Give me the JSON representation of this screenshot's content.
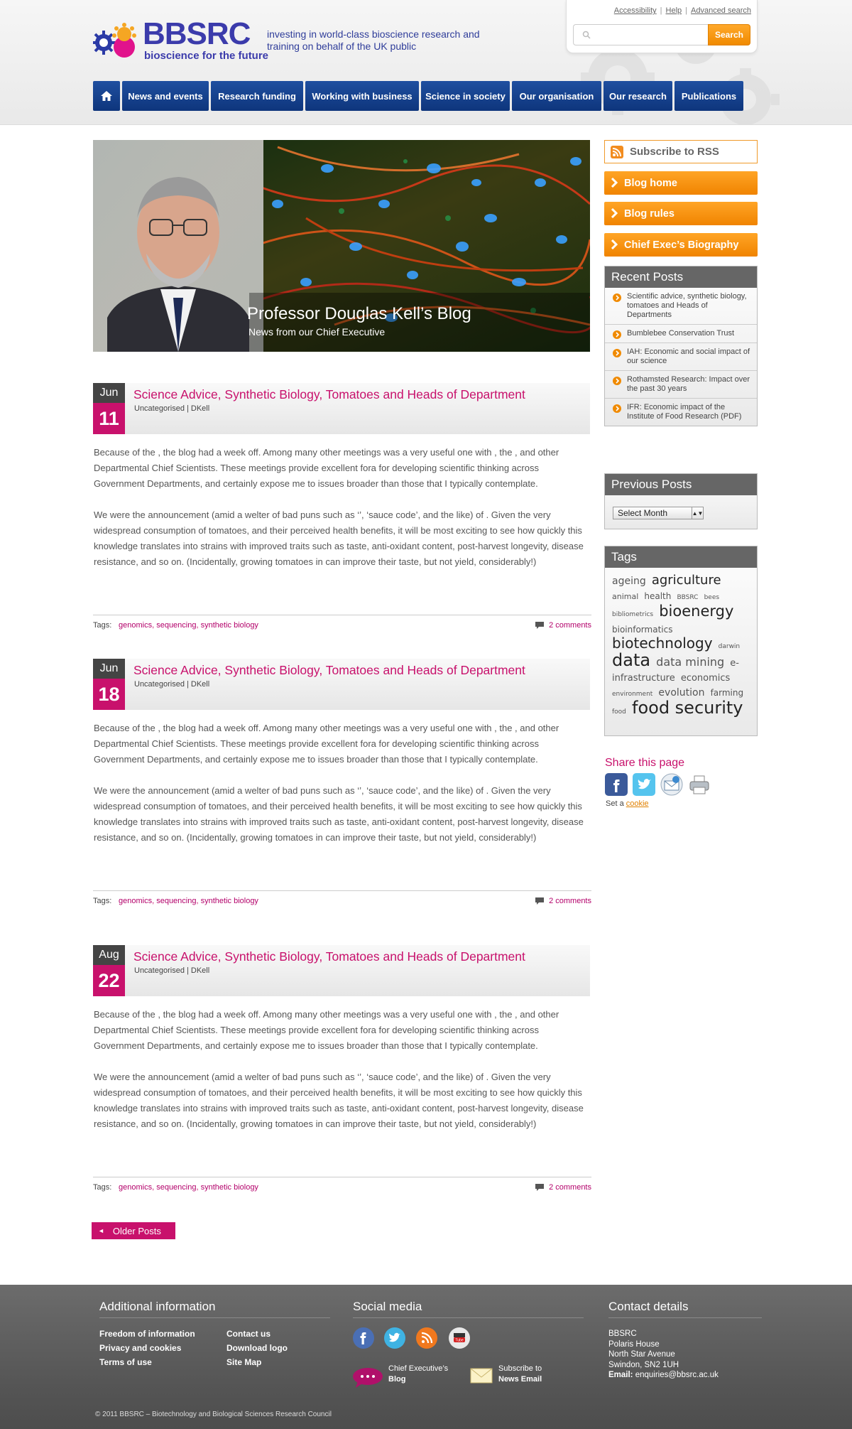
{
  "header": {
    "logo_text": "BBSRC",
    "logo_subtitle": "bioscience for the future",
    "tagline": "investing in world-class bioscience research and training on behalf of the UK public",
    "top_links": [
      "Accessibility",
      "Help",
      "Advanced search"
    ],
    "search_placeholder": "",
    "search_button": "Search"
  },
  "nav": {
    "items": [
      "News and events",
      "Research funding",
      "Working with business",
      "Science in society",
      "Our organisation",
      "Our research",
      "Publications"
    ]
  },
  "banner": {
    "title": "Professor Douglas Kell’s Blog",
    "subtitle": "News from our Chief Executive"
  },
  "posts": [
    {
      "month": "Jun",
      "day": "11",
      "title": "Science Advice, Synthetic Biology, Tomatoes and Heads of Department",
      "meta": "Uncategorised  |  DKell",
      "para1": "Because of the , the blog had a week off. Among many other meetings was a very useful one with , the , and other Departmental Chief Scientists. These meetings provide excellent fora for developing scientific thinking across Government Departments, and certainly expose me to issues broader than those that I typically contemplate.",
      "para2": "We were  the announcement (amid a welter of bad puns such as ‘’, ‘sauce code’, and the like) of . Given the very widespread consumption of tomatoes, and their perceived health benefits, it will be most exciting to see how quickly this knowledge translates into strains with improved traits such as taste, anti-oxidant content, post-harvest longevity, disease resistance, and so on. (Incidentally, growing tomatoes in  can improve their taste, but not yield, considerably!)",
      "tags_label": "Tags:",
      "tags": [
        "genomics",
        "sequencing",
        "synthetic biology"
      ],
      "comments": "2 comments"
    },
    {
      "month": "Jun",
      "day": "18",
      "title": "Science Advice, Synthetic Biology, Tomatoes and Heads of Department",
      "meta": "Uncategorised  |  DKell",
      "para1": "Because of the , the blog had a week off. Among many other meetings was a very useful one with , the , and other Departmental Chief Scientists. These meetings provide excellent fora for developing scientific thinking across Government Departments, and certainly expose me to issues broader than those that I typically contemplate.",
      "para2": "We were  the announcement (amid a welter of bad puns such as ‘’, ‘sauce code’, and the like) of . Given the very widespread consumption of tomatoes, and their perceived health benefits, it will be most exciting to see how quickly this knowledge translates into strains with improved traits such as taste, anti-oxidant content, post-harvest longevity, disease resistance, and so on. (Incidentally, growing tomatoes in  can improve their taste, but not yield, considerably!)",
      "tags_label": "Tags:",
      "tags": [
        "genomics",
        "sequencing",
        "synthetic biology"
      ],
      "comments": "2 comments"
    },
    {
      "month": "Aug",
      "day": "22",
      "title": "Science Advice, Synthetic Biology, Tomatoes and Heads of Department",
      "meta": "Uncategorised  |  DKell",
      "para1": "Because of the , the blog had a week off. Among many other meetings was a very useful one with , the , and other Departmental Chief Scientists. These meetings provide excellent fora for developing scientific thinking across Government Departments, and certainly expose me to issues broader than those that I typically contemplate.",
      "para2": "We were  the announcement (amid a welter of bad puns such as ‘’, ‘sauce code’, and the like) of . Given the very widespread consumption of tomatoes, and their perceived health benefits, it will be most exciting to see how quickly this knowledge translates into strains with improved traits such as taste, anti-oxidant content, post-harvest longevity, disease resistance, and so on. (Incidentally, growing tomatoes in  can improve their taste, but not yield, considerably!)",
      "tags_label": "Tags:",
      "tags": [
        "genomics",
        "sequencing",
        "synthetic biology"
      ],
      "comments": "2 comments"
    }
  ],
  "older_posts": "Older Posts",
  "sidebar": {
    "rss": "Subscribe to RSS",
    "buttons": [
      "Blog home",
      "Blog rules",
      "Chief Exec’s Biography"
    ],
    "recent_title": "Recent Posts",
    "recent_posts": [
      "Scientific advice, synthetic biology, tomatoes and Heads of Departments",
      "Bumblebee Conservation Trust",
      "IAH: Economic and social impact of our science",
      "Rothamsted Research: Impact over the past 30 years",
      "IFR: Economic impact of the Institute of Food Research (PDF)"
    ],
    "previous_title": "Previous Posts",
    "month_select": "Select Month",
    "tags_title": "Tags",
    "tag_cloud": [
      {
        "t": "ageing",
        "s": 14
      },
      {
        "t": "agriculture",
        "s": 18
      },
      {
        "t": "animal",
        "s": 11
      },
      {
        "t": "health",
        "s": 12
      },
      {
        "t": "BBSRC",
        "s": 9
      },
      {
        "t": "bees",
        "s": 9
      },
      {
        "t": "bibliometrics",
        "s": 9
      },
      {
        "t": "bioenergy",
        "s": 21
      },
      {
        "t": "bioinformatics",
        "s": 12
      },
      {
        "t": "biotechnology",
        "s": 20
      },
      {
        "t": "darwin",
        "s": 9
      },
      {
        "t": "data",
        "s": 24
      },
      {
        "t": "data mining",
        "s": 16
      },
      {
        "t": "e-infrastructure",
        "s": 13
      },
      {
        "t": "economics",
        "s": 13
      },
      {
        "t": "environment",
        "s": 9
      },
      {
        "t": "evolution",
        "s": 14
      },
      {
        "t": "farming",
        "s": 12
      },
      {
        "t": "food",
        "s": 9
      },
      {
        "t": "food security",
        "s": 24
      }
    ]
  },
  "share": {
    "title": "Share this page",
    "icons": [
      "facebook-icon",
      "twitter-icon",
      "email-icon",
      "print-icon"
    ],
    "cookie_prefix": "Set a",
    "cookie_link": "cookie"
  },
  "footer": {
    "additional_title": "Additional information",
    "links_col1": [
      "Freedom of information",
      "Privacy and cookies",
      "Terms of use"
    ],
    "links_col2": [
      "Contact us",
      "Download logo",
      "Site Map"
    ],
    "social_title": "Social media",
    "social_icons": [
      "facebook-icon",
      "twitter-icon",
      "rss-icon",
      "youtube-icon"
    ],
    "blog_link_line1": "Chief Executive’s",
    "blog_link_line2": "Blog",
    "news_link_line1": "Subscribe to",
    "news_link_line2": "News Email",
    "contact_title": "Contact details",
    "address": [
      "BBSRC",
      "Polaris House",
      "North Star Avenue",
      "Swindon, SN2 1UH"
    ],
    "email_label": "Email:",
    "email": "enquiries@bbsrc.ac.uk",
    "copyright": "© 2011 BBSRC – Biotechnology and Biological Sciences Research Council"
  },
  "colors": {
    "brand_blue": "#1f4fa0",
    "accent_magenta": "#c8116c",
    "accent_orange": "#f08a00"
  }
}
